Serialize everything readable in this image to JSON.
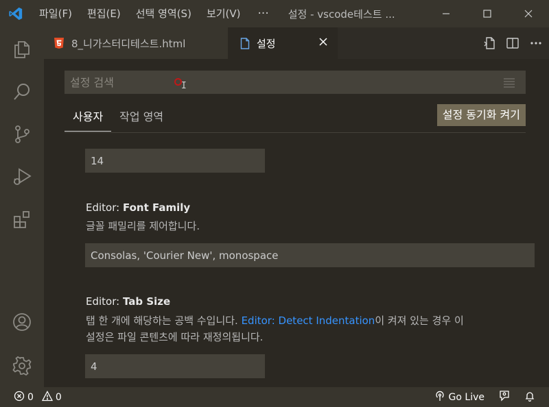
{
  "menu": {
    "items": [
      "파일(F)",
      "편집(E)",
      "선택 영역(S)",
      "보기(V)"
    ],
    "more": "···"
  },
  "window": {
    "title": "설정 - vscode테스트 ..."
  },
  "tabs": [
    {
      "label": "8_니가스터디테스트.html",
      "icon": "html5-icon"
    },
    {
      "label": "설정",
      "icon": "file-icon"
    }
  ],
  "search": {
    "placeholder": "설정 검색",
    "value": ""
  },
  "scopes": {
    "user": "사용자",
    "workspace": "작업 영역"
  },
  "sync_button": "설정 동기화 켜기",
  "settings": {
    "font_size": {
      "value": "14"
    },
    "font_family": {
      "prefix": "Editor: ",
      "name": "Font Family",
      "description": "글꼴 패밀리를 제어합니다.",
      "value": "Consolas, 'Courier New', monospace"
    },
    "tab_size": {
      "prefix": "Editor: ",
      "name": "Tab Size",
      "description_1": "탭 한 개에 해당하는 공백 수입니다. ",
      "description_link": "Editor: Detect Indentation",
      "description_2": "이 켜져 있는 경우 이",
      "description_3": "설정은 파일 콘텐츠에 따라 재정의됩니다.",
      "value": "4"
    }
  },
  "status": {
    "errors": "0",
    "warnings": "0",
    "go_live": "Go Live"
  },
  "colors": {
    "accent_blue": "#3794ff",
    "html_icon": "#e44d26",
    "vscode_logo": "#2b8fe0"
  }
}
